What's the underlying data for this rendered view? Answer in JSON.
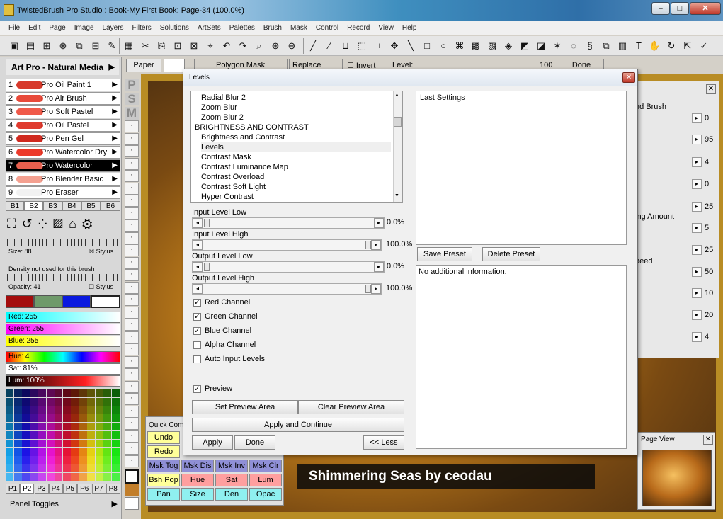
{
  "window": {
    "title": "TwistedBrush Pro Studio : Book-My First Book: Page-34 (100.0%)"
  },
  "menu": [
    "File",
    "Edit",
    "Page",
    "Image",
    "Layers",
    "Filters",
    "Solutions",
    "ArtSets",
    "Palettes",
    "Brush",
    "Mask",
    "Control",
    "Record",
    "View",
    "Help"
  ],
  "brush_panel": {
    "title": "Art Pro - Natural Media",
    "brushes": [
      {
        "num": "1",
        "label": "Pro Oil Paint 1"
      },
      {
        "num": "2",
        "label": "Pro Air Brush"
      },
      {
        "num": "3",
        "label": "Pro Soft Pastel"
      },
      {
        "num": "4",
        "label": "Pro Oil Pastel"
      },
      {
        "num": "5",
        "label": "Pro Pen Gel"
      },
      {
        "num": "6",
        "label": "Pro Watercolor Dry"
      },
      {
        "num": "7",
        "label": "Pro Watercolor"
      },
      {
        "num": "8",
        "label": "Pro Blender Basic"
      },
      {
        "num": "9",
        "label": "Pro Eraser"
      }
    ],
    "tabs": [
      "B1",
      "B2",
      "B3",
      "B4",
      "B5",
      "B6"
    ],
    "size_label": "Size: 88",
    "stylus_label": "Stylus",
    "density_note": "Density not used for this brush",
    "opacity_label": "Opacity: 41",
    "red_label": "Red: 255",
    "green_label": "Green: 255",
    "blue_label": "Blue: 255",
    "hue_label": "Hue: 4",
    "sat_label": "Sat: 81%",
    "lum_label": "Lum: 100%",
    "palette_tabs": [
      "P1",
      "P2",
      "P3",
      "P4",
      "P5",
      "P6",
      "P7",
      "P8"
    ],
    "panel_toggles": "Panel Toggles"
  },
  "psm": [
    "P",
    "S",
    "M"
  ],
  "paper_strip": {
    "paper": "Paper",
    "mask": "Polygon Mask",
    "replace": "Replace",
    "invert": "Invert",
    "level": "Level:",
    "value": "100",
    "done": "Done"
  },
  "dialog": {
    "title": "Levels",
    "filters": [
      "Radial Blur 2",
      "Zoom Blur",
      "Zoom Blur 2",
      "BRIGHTNESS AND CONTRAST",
      "Brightness and Contrast",
      "Levels",
      "Contrast Mask",
      "Contrast Luminance Map",
      "Contrast Overload",
      "Contrast Soft Light",
      "Hyper Contrast"
    ],
    "sliders": [
      {
        "label": "Input Level Low",
        "value": "0.0%"
      },
      {
        "label": "Input Level High",
        "value": "100.0%"
      },
      {
        "label": "Output Level Low",
        "value": "0.0%"
      },
      {
        "label": "Output Level High",
        "value": "100.0%"
      }
    ],
    "channels": [
      {
        "label": "Red Channel",
        "checked": true
      },
      {
        "label": "Green Channel",
        "checked": true
      },
      {
        "label": "Blue Channel",
        "checked": true
      },
      {
        "label": "Alpha Channel",
        "checked": false
      },
      {
        "label": "Auto Input Levels",
        "checked": false
      }
    ],
    "preview": "Preview",
    "set_preview": "Set Preview Area",
    "clear_preview": "Clear Preview Area",
    "apply_continue": "Apply and Continue",
    "apply": "Apply",
    "done": "Done",
    "less": "<< Less",
    "presets_first": "Last Settings",
    "save_preset": "Save Preset",
    "delete_preset": "Delete Preset",
    "info": "No additional information."
  },
  "right_panel": {
    "label_1": "nd Brush",
    "label_2": "ing Amount",
    "label_3": "peed",
    "values": [
      "0",
      "95",
      "4",
      "0",
      "25",
      "5",
      "25",
      "50",
      "10",
      "20",
      "4"
    ]
  },
  "quick_commands": {
    "title": "Quick Com",
    "buttons": [
      {
        "label": "Undo",
        "color": "#ffff99"
      },
      {
        "label": "Redo",
        "color": "#ffff99"
      },
      {
        "label": "Msk Tog",
        "color": "#8f8fd6"
      },
      {
        "label": "Msk Dis",
        "color": "#8f8fd6"
      },
      {
        "label": "Msk Inv",
        "color": "#8f8fd6"
      },
      {
        "label": "Msk Clr",
        "color": "#8f8fd6"
      },
      {
        "label": "Bsh Pop",
        "color": "#ffff99"
      },
      {
        "label": "Hue",
        "color": "#ff9f9f"
      },
      {
        "label": "Sat",
        "color": "#ff9f9f"
      },
      {
        "label": "Lum",
        "color": "#ff9f9f"
      },
      {
        "label": "Pan",
        "color": "#8ff0f0"
      },
      {
        "label": "Size",
        "color": "#8ff0f0"
      },
      {
        "label": "Den",
        "color": "#8ff0f0"
      },
      {
        "label": "Opac",
        "color": "#8ff0f0"
      }
    ]
  },
  "page_view": {
    "title": "Page View"
  },
  "canvas": {
    "caption": "Shimmering Seas by ceodau"
  }
}
